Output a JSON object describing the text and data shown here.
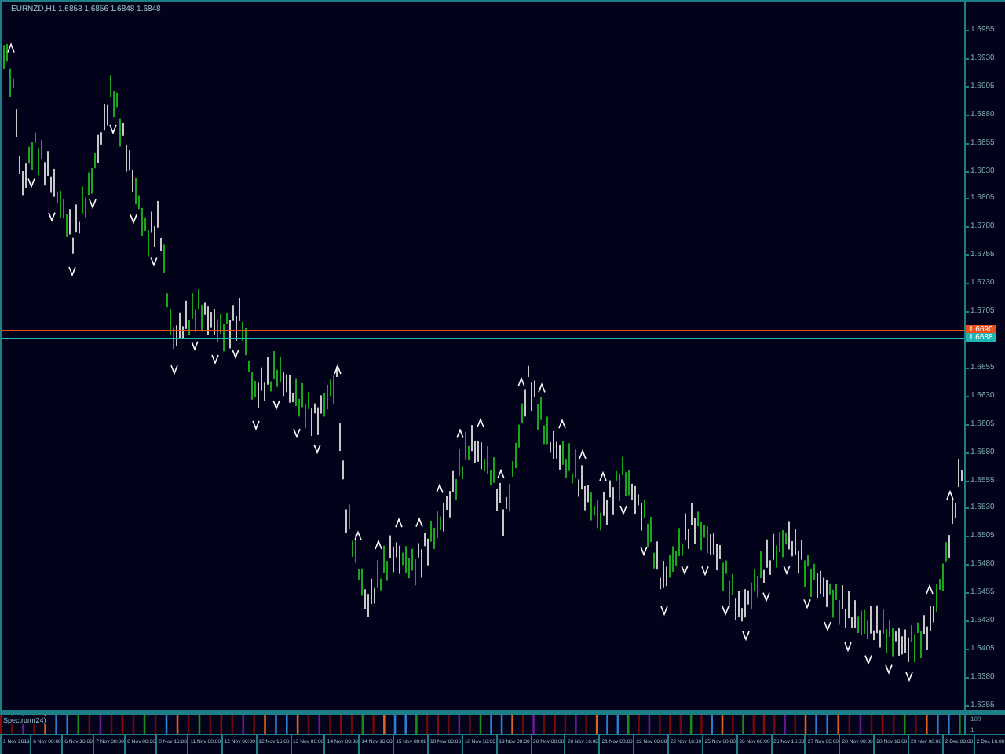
{
  "chart": {
    "title": "EURNZD,H1  1.6853 1.6856 1.6848 1.6848",
    "price_labels": [
      "1.6955",
      "1.6930",
      "1.6905",
      "1.6880",
      "1.6855",
      "1.6830",
      "1.6805",
      "1.6780",
      "1.6755",
      "1.6730",
      "1.6705",
      "1.6655",
      "1.6630",
      "1.6605",
      "1.6580",
      "1.6555",
      "1.6530",
      "1.6505",
      "1.6480",
      "1.6455",
      "1.6430",
      "1.6405",
      "1.6380",
      "1.6355"
    ],
    "price_tags": [
      {
        "label": "1.6690",
        "color": "#e8501c"
      },
      {
        "label": "1.6688",
        "color": "#20b4b4"
      }
    ]
  },
  "indicator": {
    "label": "Spectrum(24)",
    "scale": [
      "100",
      "1"
    ]
  },
  "time_labels": [
    "1 Nov 2019",
    "6 Nov 00:00",
    "6 Nov 16:00",
    "7 Nov 08:00",
    "8 Nov 00:00",
    "8 Nov 16:00",
    "11 Nov 08:00",
    "12 Nov 00:00",
    "12 Nov 16:00",
    "13 Nov 08:00",
    "14 Nov 00:00",
    "14 Nov 16:00",
    "15 Nov 08:00",
    "18 Nov 00:00",
    "18 Nov 16:00",
    "19 Nov 08:00",
    "20 Nov 00:00",
    "20 Nov 16:00",
    "21 Nov 08:00",
    "22 Nov 00:00",
    "22 Nov 16:00",
    "25 Nov 08:00",
    "26 Nov 00:00",
    "26 Nov 16:00",
    "27 Nov 08:00",
    "28 Nov 00:00",
    "28 Nov 16:00",
    "29 Nov 08:00",
    "2 Dec 00:00",
    "2 Dec 16:00"
  ]
}
